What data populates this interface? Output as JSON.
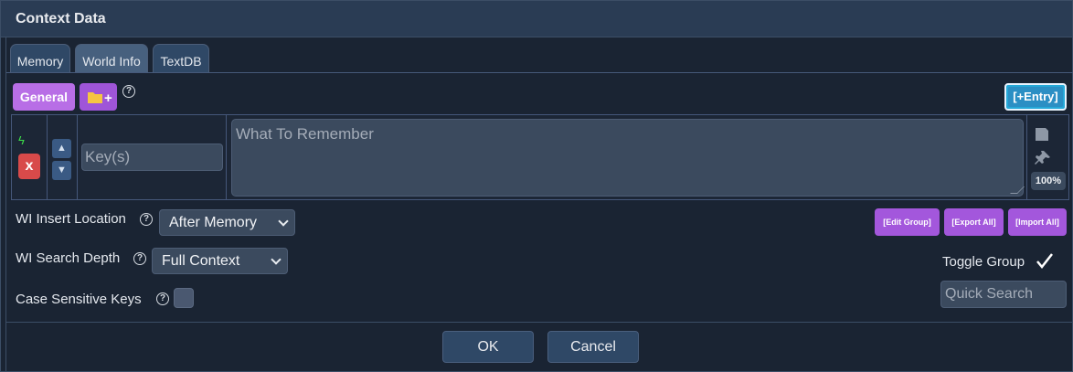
{
  "window": {
    "title": "Context Data"
  },
  "tabs": [
    {
      "label": "Memory"
    },
    {
      "label": "World Info"
    },
    {
      "label": "TextDB"
    }
  ],
  "toolbar": {
    "general_label": "General",
    "folder_icon": "folder-add-icon",
    "folder_plus": "+",
    "help_symbol": "?",
    "add_entry_label": "[+Entry]"
  },
  "entry": {
    "delete_label": "x",
    "bolt_symbol": "ϟ",
    "up_symbol": "▲",
    "down_symbol": "▼",
    "key_placeholder": "Key(s)",
    "memory_placeholder": "What To Remember",
    "probability": "100%"
  },
  "settings": {
    "insert_location_label": "WI Insert Location",
    "insert_location_value": "After Memory",
    "search_depth_label": "WI Search Depth",
    "search_depth_value": "Full Context",
    "case_sensitive_label": "Case Sensitive Keys",
    "case_sensitive_checked": false
  },
  "group_actions": {
    "edit_group": "[Edit Group]",
    "export_all": "[Export All]",
    "import_all": "[Import All]"
  },
  "group": {
    "toggle_label": "Toggle Group",
    "toggle_checked": true,
    "quick_search_placeholder": "Quick Search"
  },
  "footer": {
    "ok_label": "OK",
    "cancel_label": "Cancel"
  },
  "colors": {
    "accent_purple": "#b06ae0",
    "entry_blue": "#25a9d8",
    "delete_red": "#d84a4a",
    "background": "#1a2433"
  }
}
